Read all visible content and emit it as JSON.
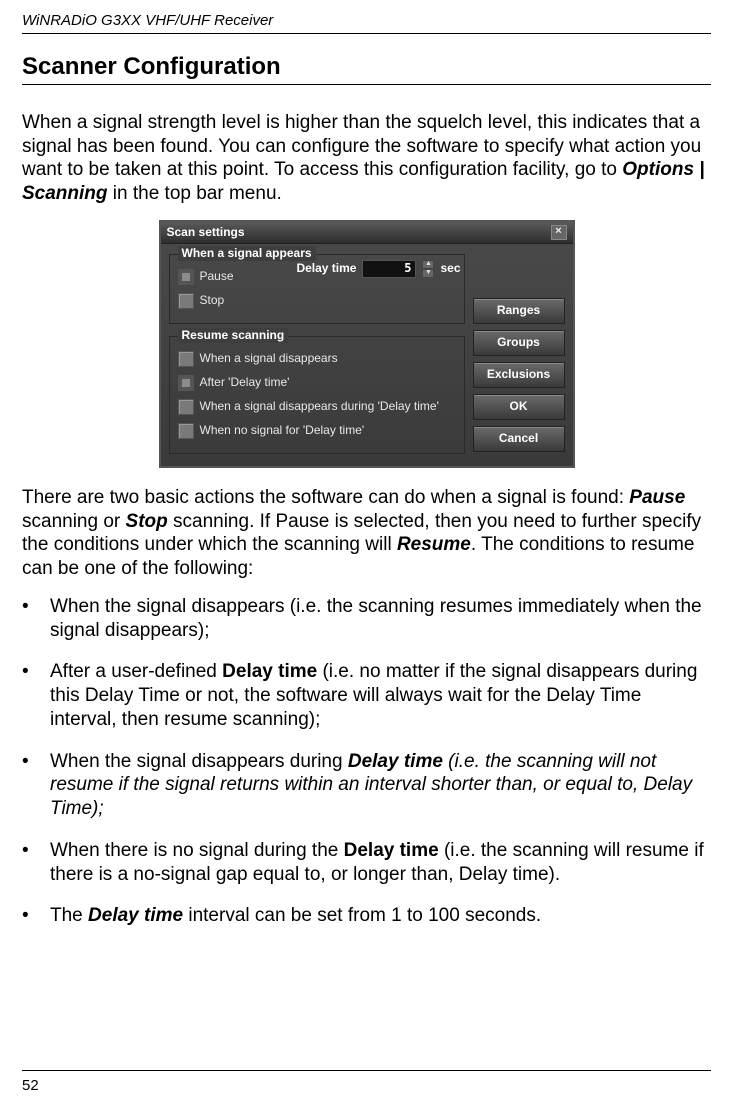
{
  "header": "WiNRADiO G3XX VHF/UHF Receiver",
  "title": "Scanner Configuration",
  "intro_parts": {
    "a": "When a signal strength level is higher than the squelch level, this indicates that a signal has been found. You can configure the software to specify what action you want to be taken at this point. To access this configuration facility, go to ",
    "b": "Options | Scanning",
    "c": " in the top bar menu."
  },
  "dialog": {
    "title": "Scan settings",
    "delay_label": "Delay time",
    "delay_value": "5",
    "delay_unit": "sec",
    "group1_title": "When a signal appears",
    "g1_opt1": "Pause",
    "g1_opt2": "Stop",
    "group2_title": "Resume scanning",
    "g2_opt1": "When a signal disappears",
    "g2_opt2": "After 'Delay time'",
    "g2_opt3": "When a signal disappears during 'Delay time'",
    "g2_opt4": "When no signal for 'Delay time'",
    "buttons": {
      "ranges": "Ranges",
      "groups": "Groups",
      "exclusions": "Exclusions",
      "ok": "OK",
      "cancel": "Cancel"
    }
  },
  "para2": {
    "a": "There are two basic actions the software can do when a signal is found: ",
    "pause": "Pause",
    "b": " scanning or ",
    "stop": "Stop",
    "c": " scanning. If Pause is selected, then you need to further specify the conditions under which the scanning will ",
    "resume": "Resume",
    "d": ". The conditions to resume can be one of the following:"
  },
  "bullets": {
    "b1": "When the signal disappears (i.e. the scanning resumes immediately when the signal disappears);",
    "b2a": "After a user-defined ",
    "b2b": "Delay time",
    "b2c": " (i.e. no matter if the signal disappears during this Delay Time or not, the software will always wait for the Delay Time interval, then resume scanning);",
    "b3a": "When the signal disappears during ",
    "b3b": "Delay time",
    "b3c": " (i.e. the scanning will not resume if the signal returns within an interval shorter than, or equal to, Delay Time);",
    "b4a": "When there is no signal during the ",
    "b4b": "Delay time",
    "b4c": " (i.e. the scanning will resume if there is a no-signal gap equal to, or longer than, Delay time).",
    "b5a": "The ",
    "b5b": "Delay time",
    "b5c": " interval can be set from 1 to 100 seconds."
  },
  "page_number": "52"
}
